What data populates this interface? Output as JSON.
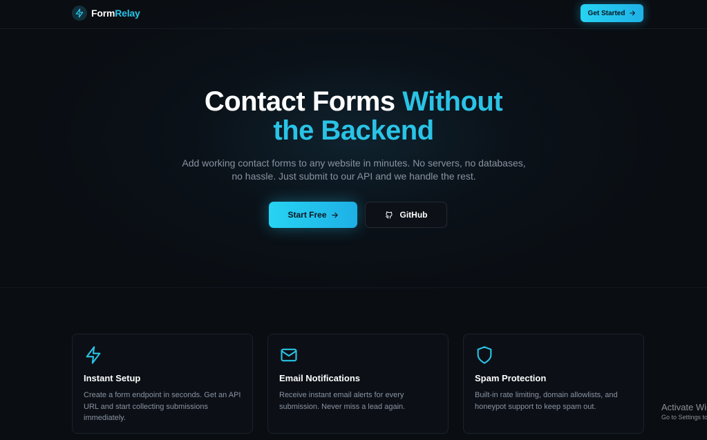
{
  "header": {
    "brand_part1": "Form",
    "brand_part2": "Relay",
    "cta_label": "Get Started"
  },
  "hero": {
    "title_line1_white": "Contact Forms ",
    "title_line1_accent": "Without",
    "title_line2_accent": "the Backend",
    "subtitle": "Add working contact forms to any website in minutes. No servers, no databases, no hassle. Just submit to our API and we handle the rest.",
    "primary_label": "Start Free",
    "secondary_label": "GitHub"
  },
  "features": [
    {
      "title": "Instant Setup",
      "description": "Create a form endpoint in seconds. Get an API URL and start collecting submissions immediately.",
      "icon": "bolt-icon"
    },
    {
      "title": "Email Notifications",
      "description": "Receive instant email alerts for every submission. Never miss a lead again.",
      "icon": "mail-icon"
    },
    {
      "title": "Spam Protection",
      "description": "Built-in rate limiting, domain allowlists, and honeypot support to keep spam out.",
      "icon": "shield-icon"
    }
  ],
  "watermark": {
    "line1": "Activate Windows",
    "line2": "Go to Settings to activate Windows."
  },
  "colors": {
    "background": "#0a0d12",
    "accent": "#2ac3e6",
    "muted_text": "#8a93a2",
    "card_border": "#1c222c"
  }
}
